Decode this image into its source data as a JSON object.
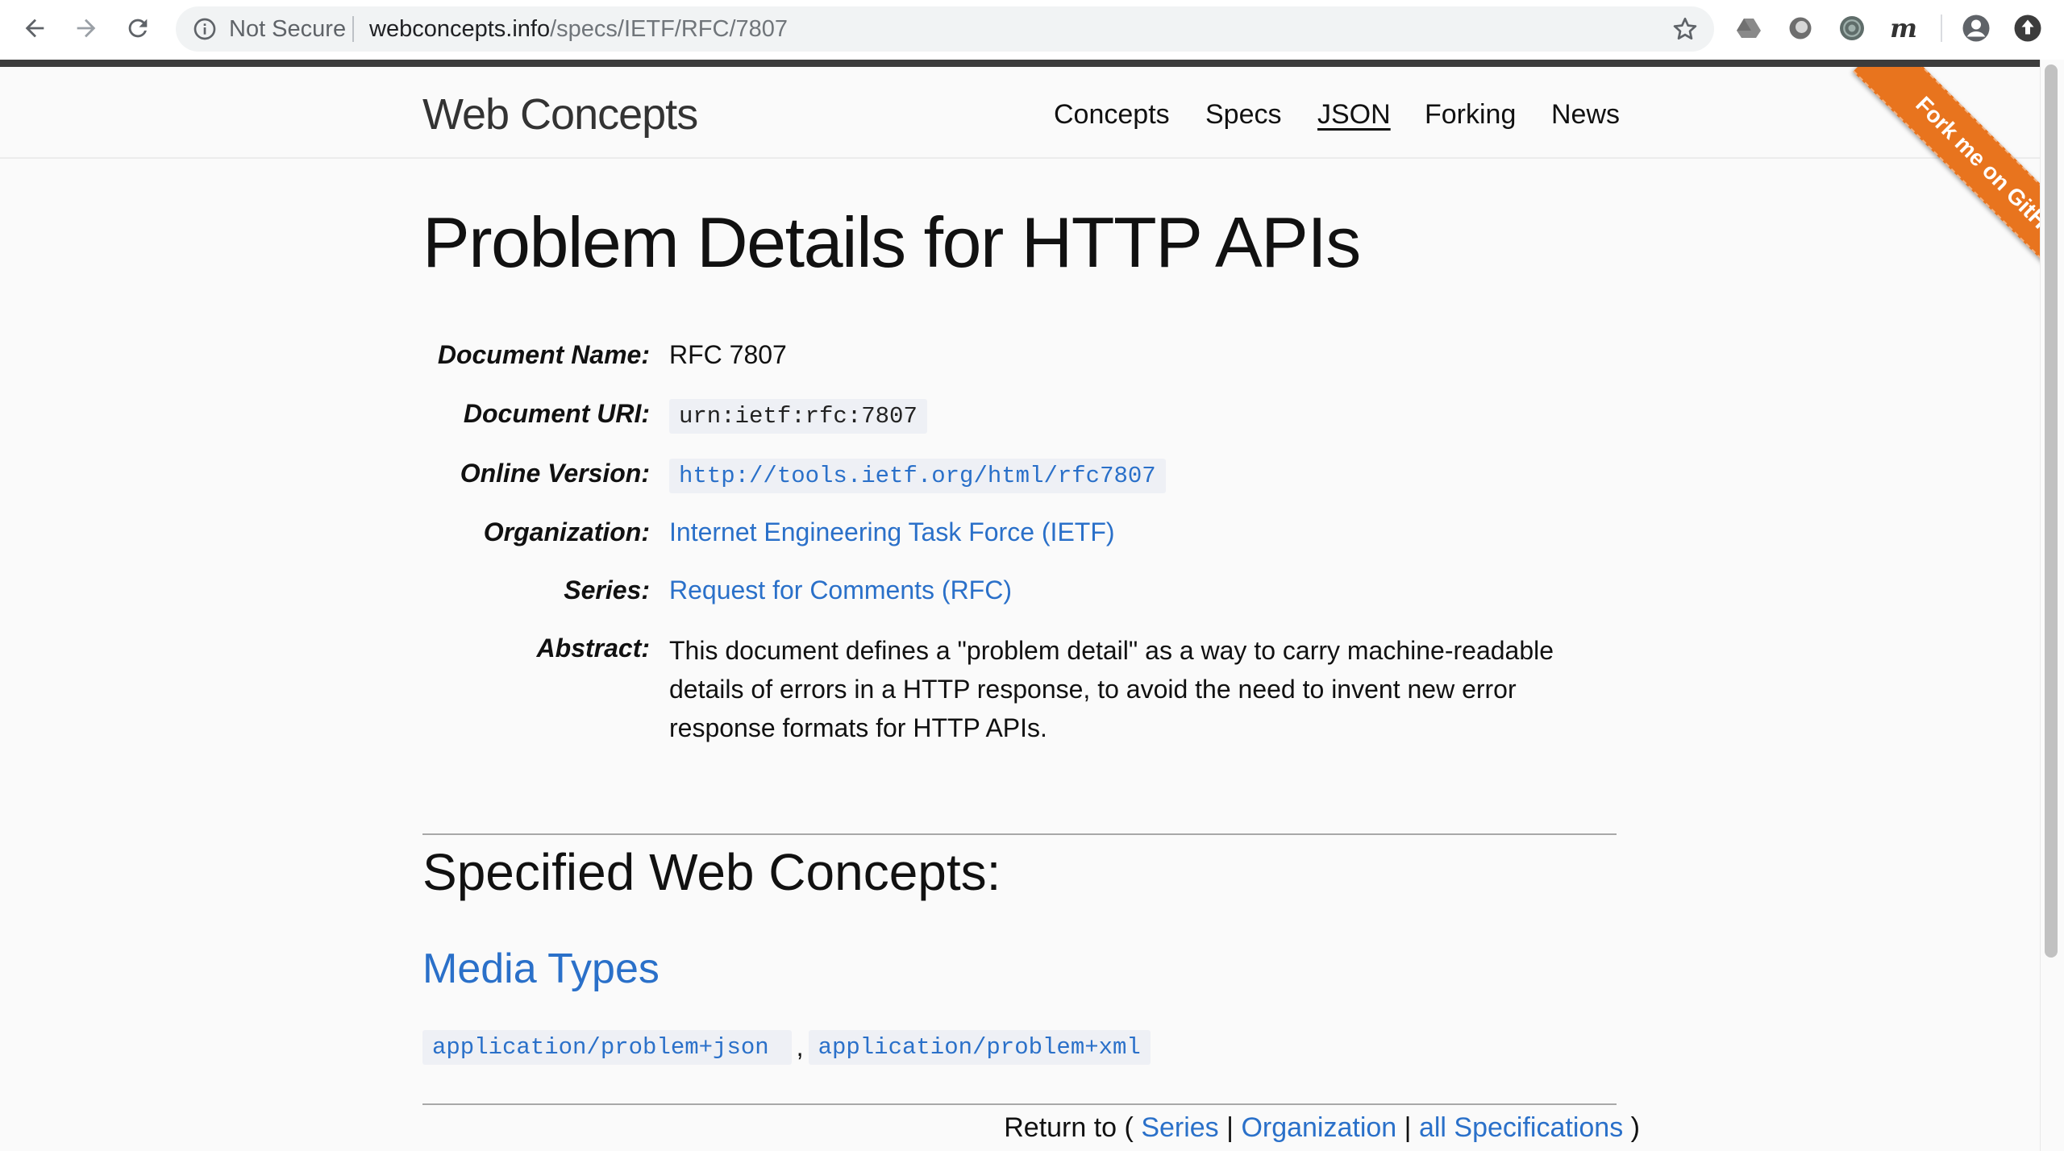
{
  "browser": {
    "security_label": "Not Secure",
    "url_host": "webconcepts.info",
    "url_path": "/specs/IETF/RFC/7807",
    "extension_m_label": "m"
  },
  "header": {
    "site_title": "Web Concepts",
    "nav": [
      "Concepts",
      "Specs",
      "JSON",
      "Forking",
      "News"
    ],
    "active_nav": "JSON"
  },
  "ribbon": {
    "label": "Fork me on GitHub",
    "color": "#e8741e"
  },
  "page": {
    "title": "Problem Details for HTTP APIs",
    "fields": {
      "document_name": {
        "label": "Document Name:",
        "value": "RFC 7807"
      },
      "document_uri": {
        "label": "Document URI:",
        "value": "urn:ietf:rfc:7807"
      },
      "online_version": {
        "label": "Online Version:",
        "value": "http://tools.ietf.org/html/rfc7807"
      },
      "organization": {
        "label": "Organization:",
        "value": "Internet Engineering Task Force (IETF)"
      },
      "series": {
        "label": "Series:",
        "value": "Request for Comments (RFC)"
      },
      "abstract": {
        "label": "Abstract:",
        "value": "This document defines a \"problem detail\" as a way to carry machine-readable details of errors in a HTTP response, to avoid the need to invent new error response formats for HTTP APIs."
      }
    },
    "section_heading": "Specified Web Concepts:",
    "subsection_heading": "Media Types",
    "media_types": [
      "application/problem+json",
      "application/problem+xml"
    ],
    "media_separator": ",",
    "return": {
      "prefix": "Return to (",
      "links": [
        "Series",
        "Organization",
        "all Specifications"
      ],
      "separator": "|",
      "suffix": ")"
    }
  },
  "colors": {
    "link": "#2a70c9",
    "code_bg": "#eef0f5"
  }
}
